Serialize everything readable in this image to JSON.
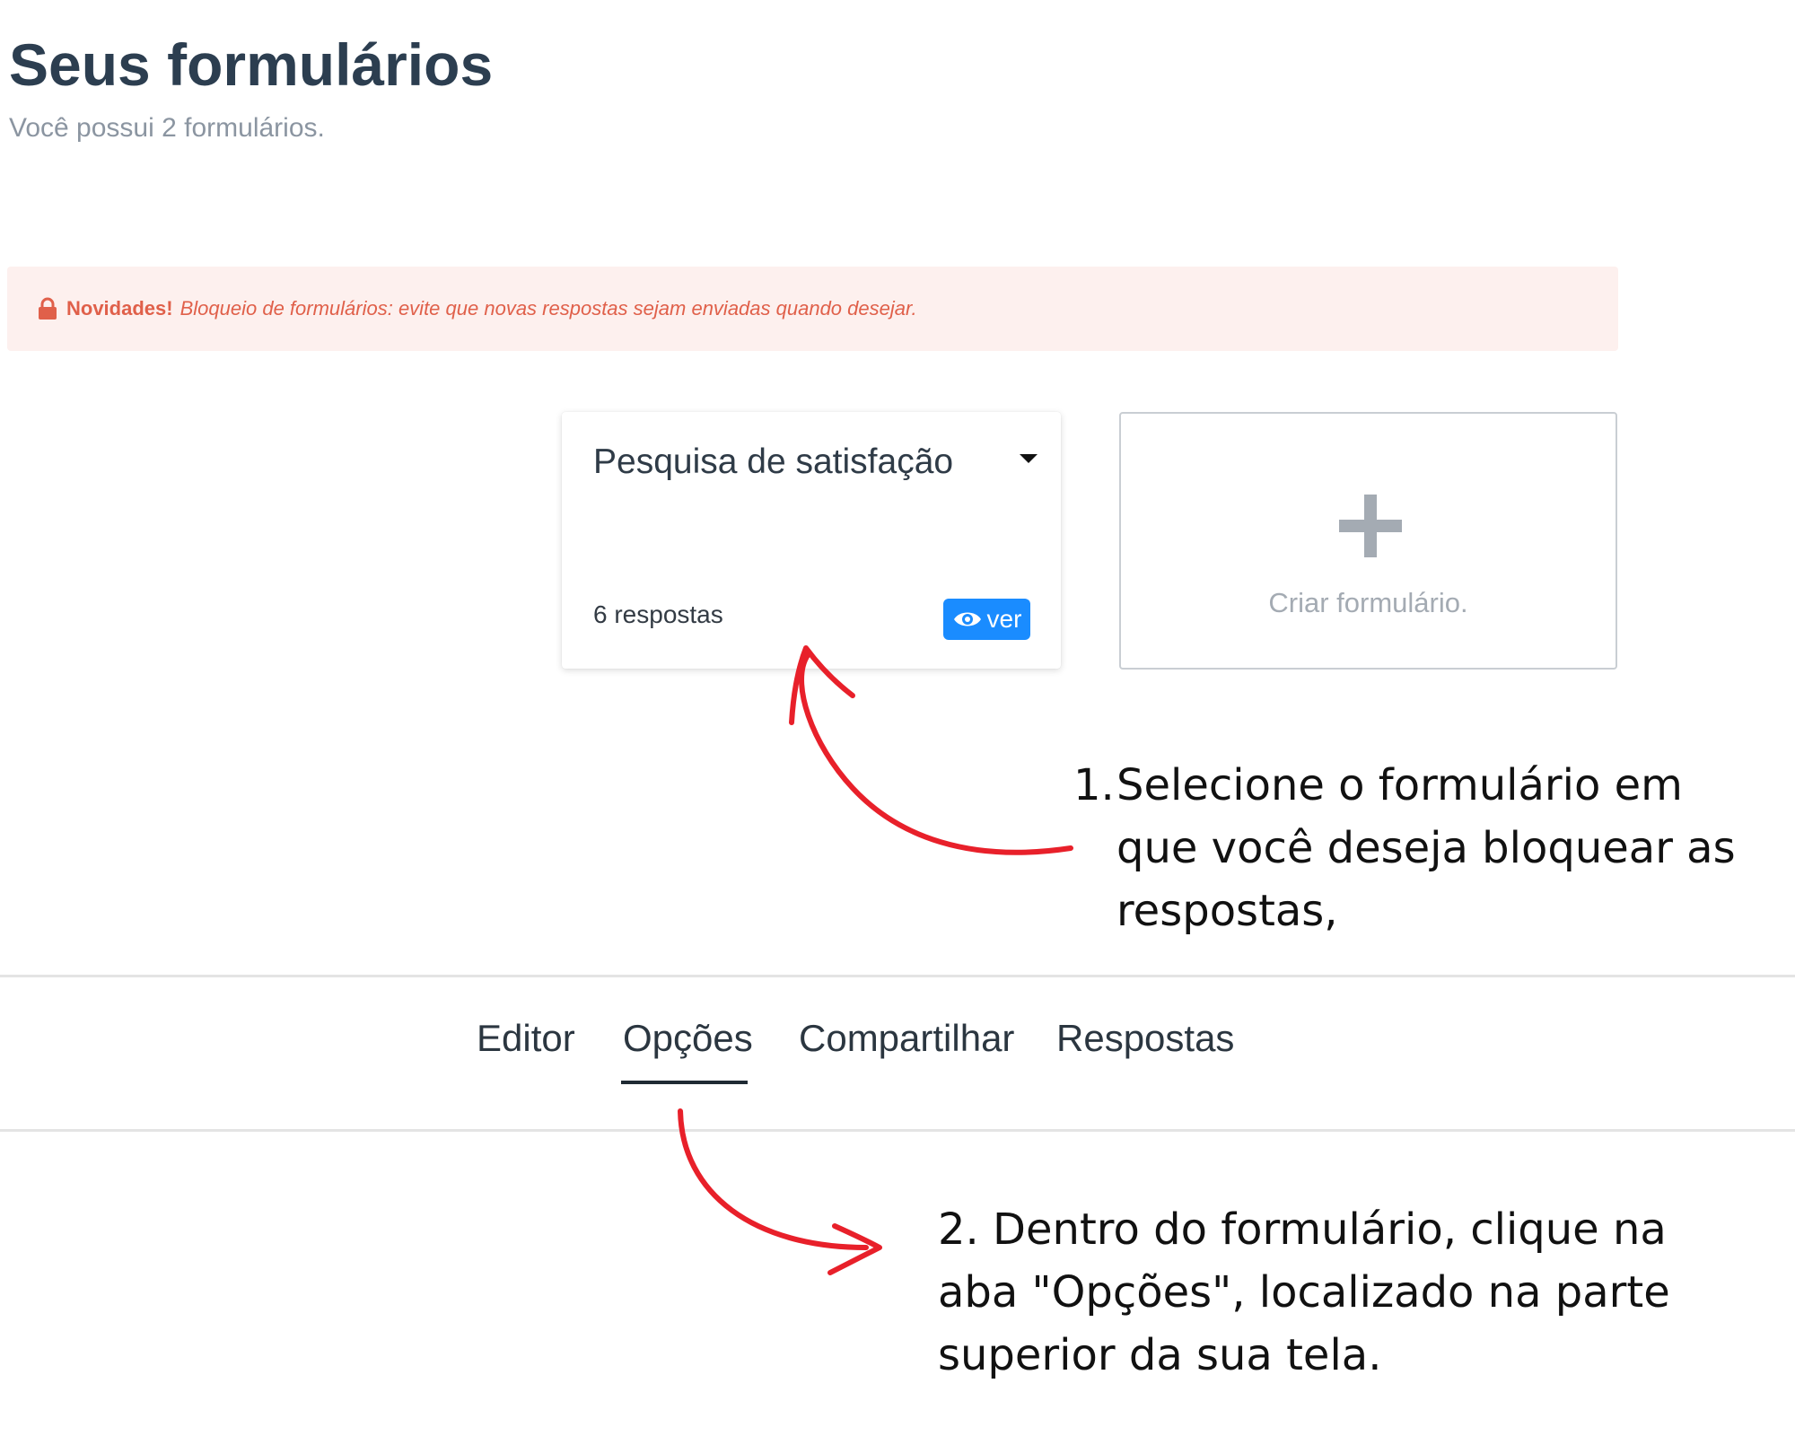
{
  "header": {
    "title": "Seus formulários",
    "subtitle": "Você possui 2 formulários."
  },
  "banner": {
    "icon": "lock-icon",
    "label": "Novidades!",
    "message": "Bloqueio de formulários: evite que novas respostas sejam enviadas quando desejar."
  },
  "form_card": {
    "title": "Pesquisa de satisfação",
    "responses": "6 respostas",
    "view_label": "ver",
    "view_icon": "eye-icon",
    "menu_icon": "caret-down-icon"
  },
  "create_card": {
    "icon": "plus-icon",
    "label": "Criar formulário."
  },
  "tabs": [
    {
      "label": "Editor"
    },
    {
      "label": "Opções",
      "active": true
    },
    {
      "label": "Compartilhar"
    },
    {
      "label": "Respostas"
    }
  ],
  "annotations": {
    "step1_number": "1.",
    "step1_text": "Selecione o formulário em que você deseja bloquear as respostas,",
    "step2_text": "2.  Dentro do formulário, clique na aba \"Opções\", localizado na parte superior da sua tela."
  },
  "colors": {
    "title": "#2c3e50",
    "banner_bg": "#fdf0ee",
    "banner_text": "#e0604a",
    "button": "#1a8cff",
    "arrow": "#e8202a"
  }
}
